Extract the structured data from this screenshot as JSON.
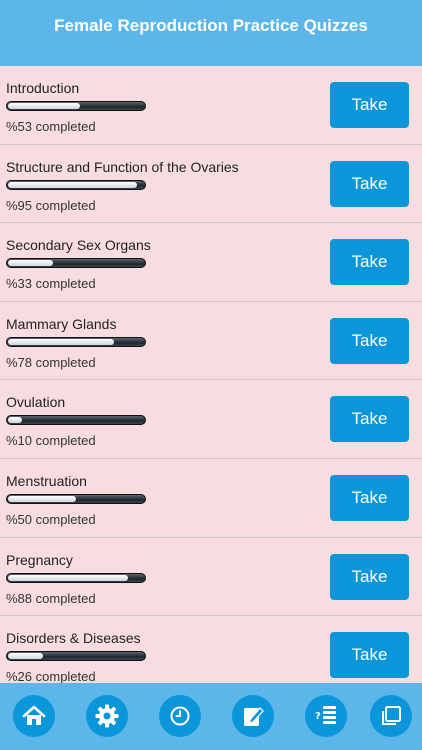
{
  "header": {
    "title": "Female Reproduction Practice Quizzes"
  },
  "take_label": "Take",
  "quizzes": [
    {
      "name": "Introduction",
      "progress": 53,
      "status": "%53 completed"
    },
    {
      "name": "Structure and Function of the Ovaries",
      "progress": 95,
      "status": "%95 completed"
    },
    {
      "name": "Secondary Sex Organs",
      "progress": 33,
      "status": "%33 completed"
    },
    {
      "name": "Mammary Glands",
      "progress": 78,
      "status": "%78 completed"
    },
    {
      "name": "Ovulation",
      "progress": 10,
      "status": "%10 completed"
    },
    {
      "name": "Menstruation",
      "progress": 50,
      "status": "%50 completed"
    },
    {
      "name": "Pregnancy",
      "progress": 88,
      "status": "%88 completed"
    },
    {
      "name": "Disorders & Diseases",
      "progress": 26,
      "status": "%26 completed"
    }
  ],
  "tabs": [
    {
      "icon": "home-icon"
    },
    {
      "icon": "gear-icon"
    },
    {
      "icon": "clock-icon"
    },
    {
      "icon": "edit-note-icon"
    },
    {
      "icon": "quiz-list-icon"
    },
    {
      "icon": "copy-icon"
    }
  ],
  "colors": {
    "header": "#5cb6ea",
    "button": "#0a96d8",
    "background": "#f8dde0"
  }
}
